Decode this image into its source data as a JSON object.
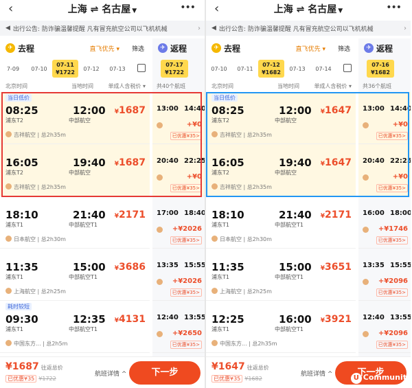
{
  "panels": [
    {
      "route": "上海 ⇌ 名古屋",
      "notice": "出行公告: 防诈骗温馨提醒 凡有冒充航空公司以飞机机械",
      "go": {
        "title": "去程",
        "pref": "直飞优先 ▾",
        "filter": "筛选",
        "dates": [
          {
            "d": "7-09",
            "p": ""
          },
          {
            "d": "07-10",
            "p": ""
          },
          {
            "d": "07-11",
            "p": "¥1722"
          },
          {
            "d": "07-12",
            "p": ""
          },
          {
            "d": "07-13",
            "p": ""
          }
        ],
        "h1": "北京时间",
        "h2": "当地时间",
        "h3": "单成人含税价 ▾",
        "flights": [
          {
            "tag": "当日低价",
            "dep": "08:25",
            "arr": "12:00",
            "dap": "浦东T2",
            "aap": "中部航空",
            "price": "1687",
            "airline": "吉祥航空 | 总2h35m"
          },
          {
            "tag": "",
            "dep": "16:05",
            "arr": "19:40",
            "dap": "浦东T2",
            "aap": "中部航空",
            "price": "1687",
            "airline": "吉祥航空 | 总2h35m"
          },
          {
            "tag": "",
            "dep": "18:10",
            "arr": "21:40",
            "dap": "浦东T1",
            "aap": "中部航空T1",
            "price": "2171",
            "airline": "日本航空 | 总2h30m"
          },
          {
            "tag": "",
            "dep": "11:35",
            "arr": "15:00",
            "dap": "浦东T1",
            "aap": "中部航空T1",
            "price": "3686",
            "airline": "上海航空 | 总2h25m"
          },
          {
            "tag": "耗时较短",
            "dep": "09:30",
            "arr": "12:35",
            "dap": "浦东T1",
            "aap": "中部航空T1",
            "price": "4131",
            "airline": "中国东方... | 总2h5m"
          }
        ]
      },
      "ret": {
        "title": "返程",
        "date": "07-17",
        "dprice": "¥1722",
        "count": "共40个航班",
        "flights": [
          {
            "dep": "13:00",
            "arr": "14:40",
            "plus": "+¥0",
            "disc": "已优惠¥35>"
          },
          {
            "dep": "20:40",
            "arr": "22:25",
            "plus": "+¥0",
            "disc": "已优惠¥35>"
          },
          {
            "dep": "17:00",
            "arr": "18:40",
            "plus": "+¥2026",
            "disc": "已优惠¥35>"
          },
          {
            "dep": "13:35",
            "arr": "15:55",
            "plus": "+¥2026",
            "disc": "已优惠¥35>"
          },
          {
            "dep": "12:40",
            "arr": "13:55",
            "plus": "+¥2650",
            "disc": "已优惠¥35>"
          }
        ]
      },
      "bottom": {
        "total": "1687",
        "total_label": "往返总价",
        "disc": "已优惠¥35",
        "orig": "¥1722",
        "details": "航班详情 ^",
        "next": "下一步"
      }
    },
    {
      "route": "上海 ⇌ 名古屋",
      "notice": "出行公告: 防诈骗温馨提醒 凡有冒充航空公司以飞机机械",
      "go": {
        "title": "去程",
        "pref": "直飞优先 ▾",
        "filter": "筛选",
        "dates": [
          {
            "d": "07-10",
            "p": ""
          },
          {
            "d": "07-11",
            "p": ""
          },
          {
            "d": "07-12",
            "p": "¥1682"
          },
          {
            "d": "07-13",
            "p": ""
          },
          {
            "d": "07-14",
            "p": ""
          }
        ],
        "h1": "北京时间",
        "h2": "当地时间",
        "h3": "单成人含税价 ▾",
        "flights": [
          {
            "tag": "当日低价",
            "dep": "08:25",
            "arr": "12:00",
            "dap": "浦东T2",
            "aap": "中部航空",
            "price": "1647",
            "airline": "吉祥航空 | 总2h35m"
          },
          {
            "tag": "",
            "dep": "16:05",
            "arr": "19:40",
            "dap": "浦东T2",
            "aap": "中部航空",
            "price": "1647",
            "airline": "吉祥航空 | 总2h35m"
          },
          {
            "tag": "",
            "dep": "18:10",
            "arr": "21:40",
            "dap": "浦东T1",
            "aap": "中部航空T1",
            "price": "2171",
            "airline": "日本航空 | 总2h30m"
          },
          {
            "tag": "",
            "dep": "11:35",
            "arr": "15:00",
            "dap": "浦东T1",
            "aap": "中部航空T1",
            "price": "3651",
            "airline": "上海航空 | 总2h25m"
          },
          {
            "tag": "",
            "dep": "12:25",
            "arr": "16:00",
            "dap": "浦东T1",
            "aap": "中部航空T1",
            "price": "3921",
            "airline": "中国东方... | 总2h35m"
          }
        ]
      },
      "ret": {
        "title": "返程",
        "date": "07-16",
        "dprice": "¥1682",
        "count": "共36个航班",
        "flights": [
          {
            "dep": "13:00",
            "arr": "14:40",
            "plus": "+¥0",
            "disc": "已优惠¥35>"
          },
          {
            "dep": "20:40",
            "arr": "22:25",
            "plus": "+¥0",
            "disc": "已优惠¥35>"
          },
          {
            "dep": "16:00",
            "arr": "18:00",
            "plus": "+¥1746",
            "disc": "已优惠¥35>"
          },
          {
            "dep": "13:35",
            "arr": "15:55",
            "plus": "+¥2096",
            "disc": "已优惠¥35>"
          },
          {
            "dep": "12:40",
            "arr": "13:55",
            "plus": "+¥2096",
            "disc": "已优惠¥35>"
          }
        ]
      },
      "bottom": {
        "total": "1647",
        "total_label": "往返总价",
        "disc": "已优惠¥35",
        "orig": "¥1682",
        "details": "航班详情 ^",
        "next": "下一步"
      }
    }
  ],
  "watermark": "Communit"
}
